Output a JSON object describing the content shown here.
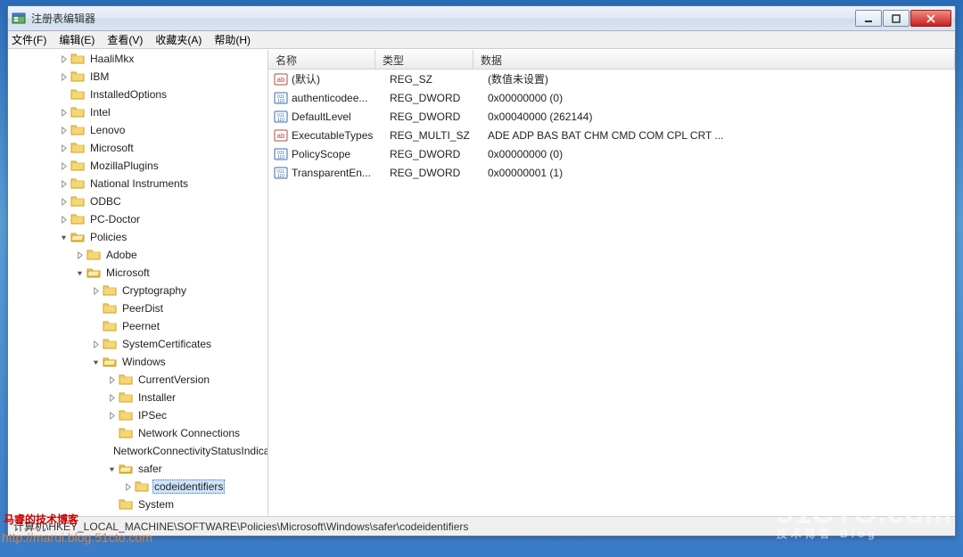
{
  "window": {
    "title": "注册表编辑器"
  },
  "menu": {
    "file": "文件(F)",
    "edit": "编辑(E)",
    "view": "查看(V)",
    "favorites": "收藏夹(A)",
    "help": "帮助(H)"
  },
  "tree": [
    {
      "label": "HaaliMkx",
      "exp": "closed"
    },
    {
      "label": "IBM",
      "exp": "closed"
    },
    {
      "label": "InstalledOptions",
      "exp": "none"
    },
    {
      "label": "Intel",
      "exp": "closed"
    },
    {
      "label": "Lenovo",
      "exp": "closed"
    },
    {
      "label": "Microsoft",
      "exp": "closed"
    },
    {
      "label": "MozillaPlugins",
      "exp": "closed"
    },
    {
      "label": "National Instruments",
      "exp": "closed"
    },
    {
      "label": "ODBC",
      "exp": "closed"
    },
    {
      "label": "PC-Doctor",
      "exp": "closed"
    },
    {
      "label": "Policies",
      "exp": "open",
      "children": [
        {
          "label": "Adobe",
          "exp": "closed"
        },
        {
          "label": "Microsoft",
          "exp": "open",
          "children": [
            {
              "label": "Cryptography",
              "exp": "closed"
            },
            {
              "label": "PeerDist",
              "exp": "none"
            },
            {
              "label": "Peernet",
              "exp": "none"
            },
            {
              "label": "SystemCertificates",
              "exp": "closed"
            },
            {
              "label": "Windows",
              "exp": "open",
              "children": [
                {
                  "label": "CurrentVersion",
                  "exp": "closed"
                },
                {
                  "label": "Installer",
                  "exp": "closed"
                },
                {
                  "label": "IPSec",
                  "exp": "closed"
                },
                {
                  "label": "Network Connections",
                  "exp": "none"
                },
                {
                  "label": "NetworkConnectivityStatusIndicator",
                  "exp": "none"
                },
                {
                  "label": "safer",
                  "exp": "open",
                  "children": [
                    {
                      "label": "codeidentifiers",
                      "exp": "closed",
                      "selected": true
                    }
                  ]
                },
                {
                  "label": "System",
                  "exp": "none"
                }
              ]
            }
          ]
        }
      ]
    }
  ],
  "list": {
    "col_name": "名称",
    "col_type": "类型",
    "col_data": "数据",
    "rows": [
      {
        "icon": "sz",
        "name": "(默认)",
        "type": "REG_SZ",
        "data": "(数值未设置)"
      },
      {
        "icon": "dw",
        "name": "authenticodee...",
        "type": "REG_DWORD",
        "data": "0x00000000 (0)"
      },
      {
        "icon": "dw",
        "name": "DefaultLevel",
        "type": "REG_DWORD",
        "data": "0x00040000 (262144)"
      },
      {
        "icon": "sz",
        "name": "ExecutableTypes",
        "type": "REG_MULTI_SZ",
        "data": "ADE ADP BAS BAT CHM CMD COM CPL CRT ..."
      },
      {
        "icon": "dw",
        "name": "PolicyScope",
        "type": "REG_DWORD",
        "data": "0x00000000 (0)"
      },
      {
        "icon": "dw",
        "name": "TransparentEn...",
        "type": "REG_DWORD",
        "data": "0x00000001 (1)"
      }
    ]
  },
  "statusbar": "计算机\\HKEY_LOCAL_MACHINE\\SOFTWARE\\Policies\\Microsoft\\Windows\\safer\\codeidentifiers",
  "watermark": {
    "left1": "马睿的技术博客",
    "left2": "http://marui.blog.51cto.com",
    "right_big": "51CTO.com",
    "right_small": "技术博客   Blog"
  }
}
